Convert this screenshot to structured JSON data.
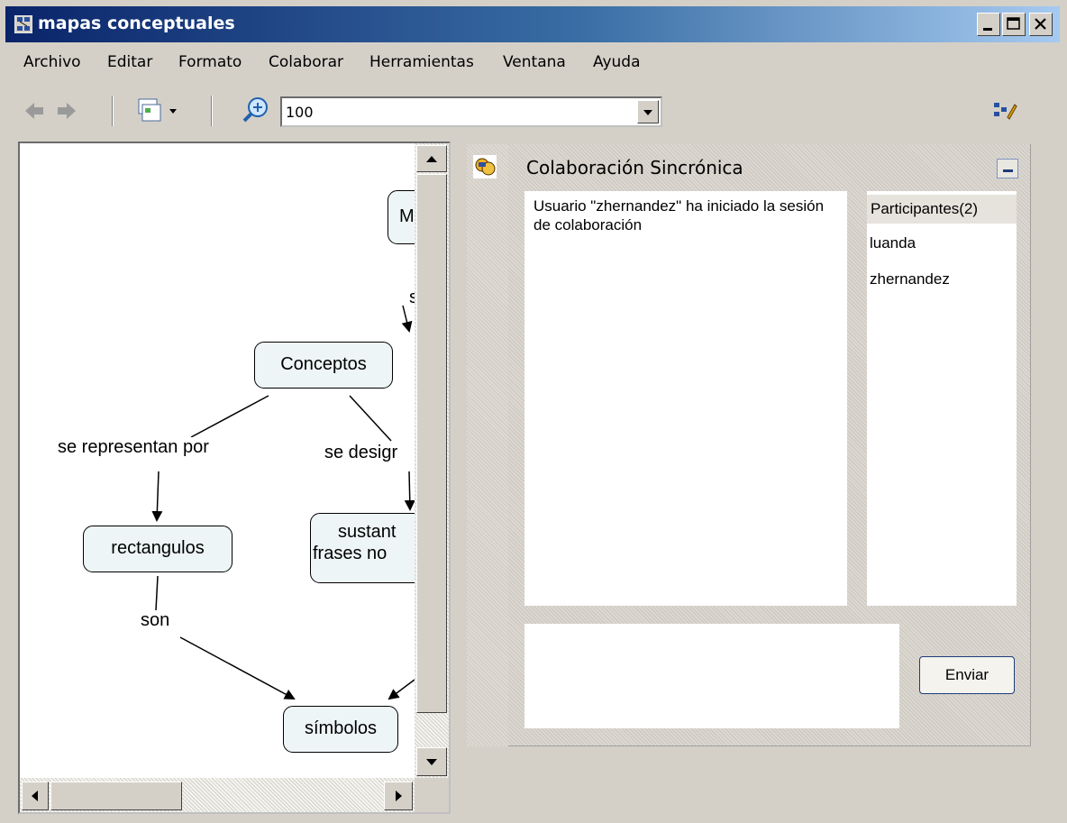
{
  "window": {
    "title": "mapas conceptuales"
  },
  "menu": [
    "Archivo",
    "Editar",
    "Formato",
    "Colaborar",
    "Herramientas",
    "Ventana",
    "Ayuda"
  ],
  "toolbar": {
    "zoom_value": "100"
  },
  "map": {
    "nodes": {
      "top": "M",
      "conceptos": "Conceptos",
      "rectangulos": "rectangulos",
      "sustant_line1": "sustant",
      "sustant_line2": "frases no",
      "simbolos": "símbolos"
    },
    "links": {
      "top_link": "s",
      "se_representan": "se representan por",
      "se_designan": "se desigr",
      "son": "son"
    }
  },
  "collab": {
    "title": "Colaboración Sincrónica",
    "log_message": "Usuario \"zhernandez\" ha iniciado la sesión de colaboración",
    "participants_header": "Participantes(2)",
    "participants": [
      "luanda",
      "zhernandez"
    ],
    "send_label": "Enviar",
    "message_value": ""
  },
  "icons": {
    "app": "concept-map-icon",
    "back": "back-arrow-icon",
    "forward": "forward-arrow-icon",
    "view": "view-menu-icon",
    "zoom": "zoom-in-icon",
    "tools": "edit-tools-icon",
    "collab": "collaboration-icon"
  },
  "colors": {
    "titlebar": "#0a246a",
    "node_fill": "#eef5f6",
    "send_border": "#1f3b7a"
  }
}
